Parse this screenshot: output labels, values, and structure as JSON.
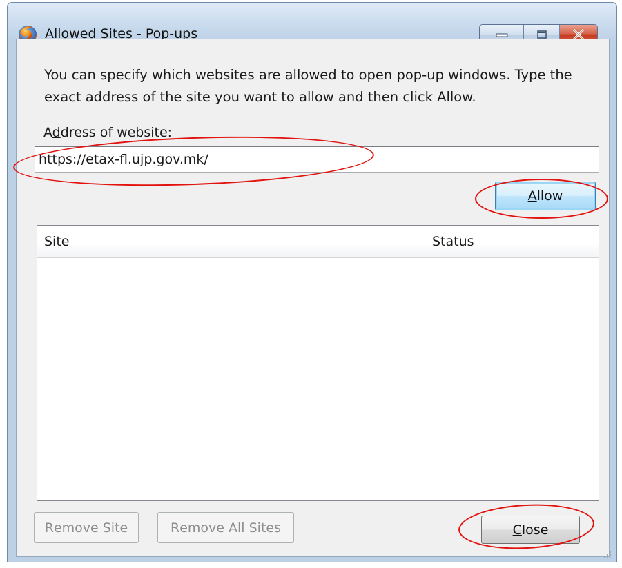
{
  "window": {
    "title": "Allowed Sites - Pop-ups",
    "app_icon": "firefox-icon",
    "caption_buttons": [
      "minimize-icon",
      "maximize-icon",
      "close-icon"
    ]
  },
  "description": "You can specify which websites are allowed to open pop-up windows. Type the exact address of the site you want to allow and then click Allow.",
  "address": {
    "label_pre": "A",
    "label_accel": "d",
    "label_post": "dress of website:",
    "value": "https://etax-fl.ujp.gov.mk/"
  },
  "allow_button": {
    "accel": "A",
    "rest": "llow"
  },
  "site_list": {
    "columns": [
      "Site",
      "Status"
    ],
    "rows": []
  },
  "remove_site_button": {
    "accel": "R",
    "rest": "emove Site",
    "disabled": true
  },
  "remove_all_button": {
    "pre": "R",
    "accel": "e",
    "rest": "move All Sites",
    "disabled": true
  },
  "close_button": {
    "accel": "C",
    "rest": "lose"
  },
  "colors": {
    "annotation": "#e2120f",
    "allow_button_focus": "#3c7fb1",
    "disabled_text": "#8d8d8d",
    "close_caption_red": "#c43a1f"
  }
}
